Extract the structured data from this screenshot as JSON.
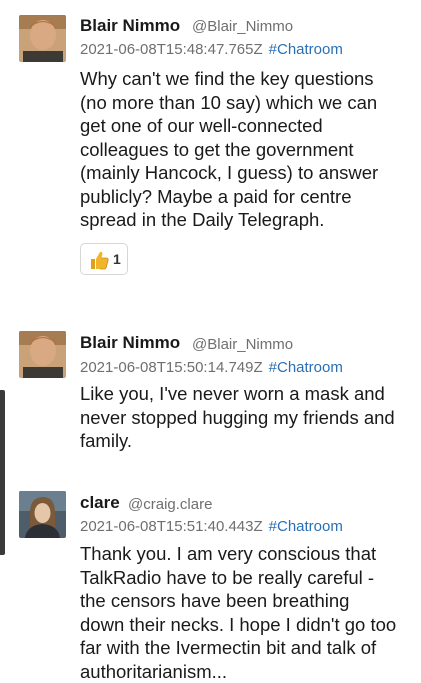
{
  "messages": [
    {
      "author": "Blair Nimmo",
      "handle": "@Blair_Nimmo",
      "timestamp": "2021-06-08T15:48:47.765Z",
      "channel": "#Chatroom",
      "avatar_icon": "user-photo-avatar",
      "lines": [
        "Why can't we find the key questions",
        "(no more than 10 say) which we can",
        "get one of our well-connected",
        "colleagues to get the government",
        "(mainly Hancock, I guess) to answer",
        "publicly? Maybe a paid for centre",
        "spread in the Daily Telegraph."
      ],
      "reaction": {
        "icon": "thumbs-up-icon",
        "count": "1"
      }
    },
    {
      "author": "Blair Nimmo",
      "handle": "@Blair_Nimmo",
      "timestamp": "2021-06-08T15:50:14.749Z",
      "channel": "#Chatroom",
      "avatar_icon": "user-photo-avatar",
      "lines": [
        "Like you, I've never worn a mask and",
        "never stopped hugging my friends and",
        "family."
      ]
    },
    {
      "author": "clare",
      "handle": "@craig.clare",
      "timestamp": "2021-06-08T15:51:40.443Z",
      "channel": "#Chatroom",
      "avatar_icon": "user-photo-avatar",
      "lines": [
        "Thank you. I am very conscious that",
        "TalkRadio have to be really careful -",
        "the censors have been breathing",
        "down their necks. I hope I didn't go too",
        "far with the Ivermectin bit and talk of",
        "authoritarianism..."
      ]
    }
  ],
  "colors": {
    "link": "#2a6fb5",
    "muted": "#6f6f6f",
    "text": "#1a1a1a"
  }
}
